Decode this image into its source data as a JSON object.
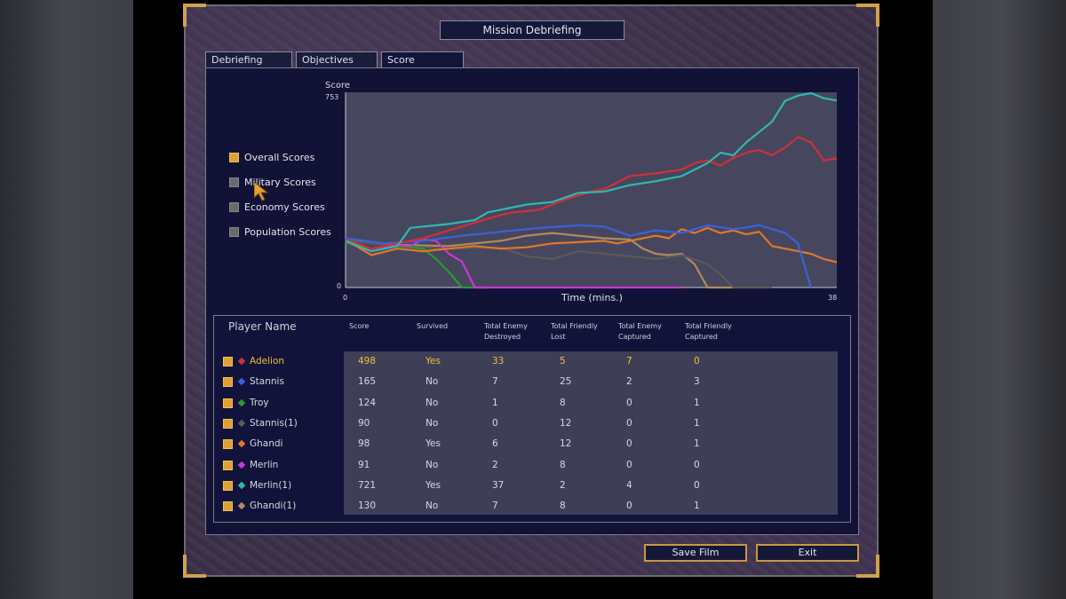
{
  "window": {
    "title": "Mission Debriefing"
  },
  "tabs": [
    {
      "label": "Debriefing"
    },
    {
      "label": "Objectives"
    },
    {
      "label": "Score"
    }
  ],
  "categories": [
    {
      "label": "Overall Scores",
      "selected": true
    },
    {
      "label": "Military Scores",
      "selected": false
    },
    {
      "label": "Economy Scores",
      "selected": false
    },
    {
      "label": "Population Scores",
      "selected": false
    }
  ],
  "chart_data": {
    "type": "line",
    "title": "",
    "xlabel": "Time (mins.)",
    "ylabel": "Score",
    "xlim": [
      0,
      38
    ],
    "ylim": [
      0,
      753
    ],
    "x_ticks": [
      "0",
      "38"
    ],
    "y_ticks": [
      "0",
      "753"
    ],
    "grid": false,
    "series": [
      {
        "color": "#2fb8b0",
        "points": [
          [
            0,
            180
          ],
          [
            2,
            140
          ],
          [
            4,
            160
          ],
          [
            5,
            230
          ],
          [
            7,
            240
          ],
          [
            8,
            245
          ],
          [
            10,
            260
          ],
          [
            11,
            290
          ],
          [
            12,
            300
          ],
          [
            14,
            320
          ],
          [
            16,
            330
          ],
          [
            18,
            365
          ],
          [
            20,
            370
          ],
          [
            22,
            395
          ],
          [
            24,
            410
          ],
          [
            26,
            430
          ],
          [
            28,
            480
          ],
          [
            29,
            520
          ],
          [
            30,
            510
          ],
          [
            31,
            560
          ],
          [
            32,
            600
          ],
          [
            33,
            640
          ],
          [
            34,
            720
          ],
          [
            35,
            740
          ],
          [
            36,
            750
          ],
          [
            37,
            730
          ],
          [
            38,
            721
          ]
        ]
      },
      {
        "color": "#d03038",
        "points": [
          [
            0,
            185
          ],
          [
            2,
            150
          ],
          [
            4,
            170
          ],
          [
            6,
            190
          ],
          [
            8,
            220
          ],
          [
            10,
            250
          ],
          [
            12,
            280
          ],
          [
            13,
            290
          ],
          [
            15,
            300
          ],
          [
            17,
            340
          ],
          [
            19,
            370
          ],
          [
            20,
            380
          ],
          [
            22,
            430
          ],
          [
            24,
            440
          ],
          [
            26,
            455
          ],
          [
            27,
            480
          ],
          [
            28,
            490
          ],
          [
            29,
            470
          ],
          [
            30,
            500
          ],
          [
            31,
            520
          ],
          [
            32,
            530
          ],
          [
            33,
            510
          ],
          [
            34,
            540
          ],
          [
            35,
            580
          ],
          [
            36,
            560
          ],
          [
            37,
            490
          ],
          [
            38,
            498
          ]
        ]
      },
      {
        "color": "#3a62d8",
        "points": [
          [
            0,
            190
          ],
          [
            3,
            170
          ],
          [
            6,
            180
          ],
          [
            9,
            200
          ],
          [
            12,
            215
          ],
          [
            15,
            230
          ],
          [
            18,
            240
          ],
          [
            20,
            235
          ],
          [
            22,
            200
          ],
          [
            24,
            220
          ],
          [
            26,
            210
          ],
          [
            28,
            240
          ],
          [
            30,
            225
          ],
          [
            32,
            240
          ],
          [
            34,
            210
          ],
          [
            35,
            170
          ],
          [
            36,
            0
          ]
        ]
      },
      {
        "color": "#e07828",
        "points": [
          [
            0,
            185
          ],
          [
            2,
            125
          ],
          [
            4,
            150
          ],
          [
            6,
            140
          ],
          [
            8,
            150
          ],
          [
            10,
            160
          ],
          [
            12,
            150
          ],
          [
            14,
            155
          ],
          [
            16,
            170
          ],
          [
            18,
            175
          ],
          [
            20,
            180
          ],
          [
            21,
            170
          ],
          [
            22,
            180
          ],
          [
            24,
            200
          ],
          [
            25,
            190
          ],
          [
            26,
            225
          ],
          [
            27,
            210
          ],
          [
            28,
            230
          ],
          [
            29,
            210
          ],
          [
            30,
            220
          ],
          [
            31,
            205
          ],
          [
            32,
            215
          ],
          [
            33,
            160
          ],
          [
            34,
            150
          ],
          [
            35,
            140
          ],
          [
            36,
            130
          ],
          [
            37,
            110
          ],
          [
            38,
            98
          ]
        ]
      },
      {
        "color": "#c838d0",
        "points": [
          [
            0,
            180
          ],
          [
            2,
            140
          ],
          [
            4,
            165
          ],
          [
            5,
            160
          ],
          [
            6,
            185
          ],
          [
            7,
            180
          ],
          [
            8,
            130
          ],
          [
            9,
            100
          ],
          [
            10,
            0
          ],
          [
            26,
            0
          ]
        ]
      },
      {
        "color": "#2a9a30",
        "points": [
          [
            0,
            175
          ],
          [
            2,
            140
          ],
          [
            4,
            160
          ],
          [
            6,
            150
          ],
          [
            7,
            110
          ],
          [
            8,
            60
          ],
          [
            9,
            0
          ],
          [
            11,
            0
          ]
        ]
      },
      {
        "color": "#5a5a5a",
        "points": [
          [
            0,
            180
          ],
          [
            4,
            160
          ],
          [
            8,
            150
          ],
          [
            12,
            155
          ],
          [
            14,
            120
          ],
          [
            16,
            110
          ],
          [
            18,
            140
          ],
          [
            20,
            130
          ],
          [
            22,
            120
          ],
          [
            24,
            110
          ],
          [
            26,
            125
          ],
          [
            28,
            90
          ],
          [
            29,
            50
          ],
          [
            30,
            0
          ],
          [
            33,
            0
          ]
        ]
      },
      {
        "color": "#b08a60",
        "points": [
          [
            0,
            180
          ],
          [
            4,
            165
          ],
          [
            8,
            160
          ],
          [
            10,
            170
          ],
          [
            12,
            180
          ],
          [
            14,
            200
          ],
          [
            16,
            210
          ],
          [
            18,
            200
          ],
          [
            20,
            190
          ],
          [
            22,
            185
          ],
          [
            23,
            150
          ],
          [
            24,
            130
          ],
          [
            25,
            125
          ],
          [
            26,
            130
          ],
          [
            27,
            90
          ],
          [
            28,
            0
          ],
          [
            30,
            0
          ]
        ]
      }
    ]
  },
  "table": {
    "headers": {
      "player": "Player Name",
      "score": "Score",
      "survived": "Survived",
      "enemy_destroyed": "Total Enemy\nDestroyed",
      "friendly_lost": "Total Friendly\nLost",
      "enemy_captured": "Total Enemy\nCaptured",
      "friendly_captured": "Total Friendly\nCaptured"
    },
    "rows": [
      {
        "name": "Adelion",
        "color": "#d03038",
        "score": "498",
        "survived": "Yes",
        "enemy_destroyed": "33",
        "friendly_lost": "5",
        "enemy_captured": "7",
        "friendly_captured": "0"
      },
      {
        "name": "Stannis",
        "color": "#3a62d8",
        "score": "165",
        "survived": "No",
        "enemy_destroyed": "7",
        "friendly_lost": "25",
        "enemy_captured": "2",
        "friendly_captured": "3"
      },
      {
        "name": "Troy",
        "color": "#2a9a30",
        "score": "124",
        "survived": "No",
        "enemy_destroyed": "1",
        "friendly_lost": "8",
        "enemy_captured": "0",
        "friendly_captured": "1"
      },
      {
        "name": "Stannis(1)",
        "color": "#5a5a5a",
        "score": "90",
        "survived": "No",
        "enemy_destroyed": "0",
        "friendly_lost": "12",
        "enemy_captured": "0",
        "friendly_captured": "1"
      },
      {
        "name": "Ghandi",
        "color": "#e07828",
        "score": "98",
        "survived": "Yes",
        "enemy_destroyed": "6",
        "friendly_lost": "12",
        "enemy_captured": "0",
        "friendly_captured": "1"
      },
      {
        "name": "Merlin",
        "color": "#c838d0",
        "score": "91",
        "survived": "No",
        "enemy_destroyed": "2",
        "friendly_lost": "8",
        "enemy_captured": "0",
        "friendly_captured": "0"
      },
      {
        "name": "Merlin(1)",
        "color": "#2fb8b0",
        "score": "721",
        "survived": "Yes",
        "enemy_destroyed": "37",
        "friendly_lost": "2",
        "enemy_captured": "4",
        "friendly_captured": "0"
      },
      {
        "name": "Ghandi(1)",
        "color": "#b08a60",
        "score": "130",
        "survived": "No",
        "enemy_destroyed": "7",
        "friendly_lost": "8",
        "enemy_captured": "0",
        "friendly_captured": "1"
      }
    ]
  },
  "buttons": {
    "save_film": "Save Film",
    "exit": "Exit"
  }
}
